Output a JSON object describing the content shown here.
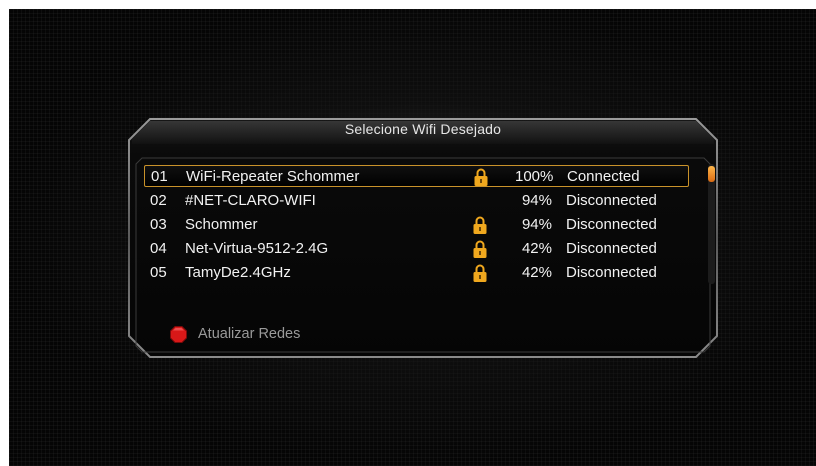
{
  "dialog": {
    "title": "Selecione Wifi Desejado"
  },
  "networks": [
    {
      "num": "01",
      "name": "WiFi-Repeater Schommer",
      "locked": true,
      "signal": "100%",
      "status": "Connected",
      "selected": true
    },
    {
      "num": "02",
      "name": "#NET-CLARO-WIFI",
      "locked": false,
      "signal": "94%",
      "status": "Disconnected",
      "selected": false
    },
    {
      "num": "03",
      "name": "Schommer",
      "locked": true,
      "signal": "94%",
      "status": "Disconnected",
      "selected": false
    },
    {
      "num": "04",
      "name": "Net-Virtua-9512-2.4G",
      "locked": true,
      "signal": "42%",
      "status": "Disconnected",
      "selected": false
    },
    {
      "num": "05",
      "name": "TamyDe2.4GHz",
      "locked": true,
      "signal": "42%",
      "status": "Disconnected",
      "selected": false
    }
  ],
  "footer": {
    "red_button_icon": "red-button-icon",
    "red_button_label": "Atualizar Redes"
  },
  "colors": {
    "selection_border": "#c9922a",
    "lock_icon": "#f0a81e",
    "scroll_thumb": "#f08a24",
    "red_button": "#d81818"
  }
}
